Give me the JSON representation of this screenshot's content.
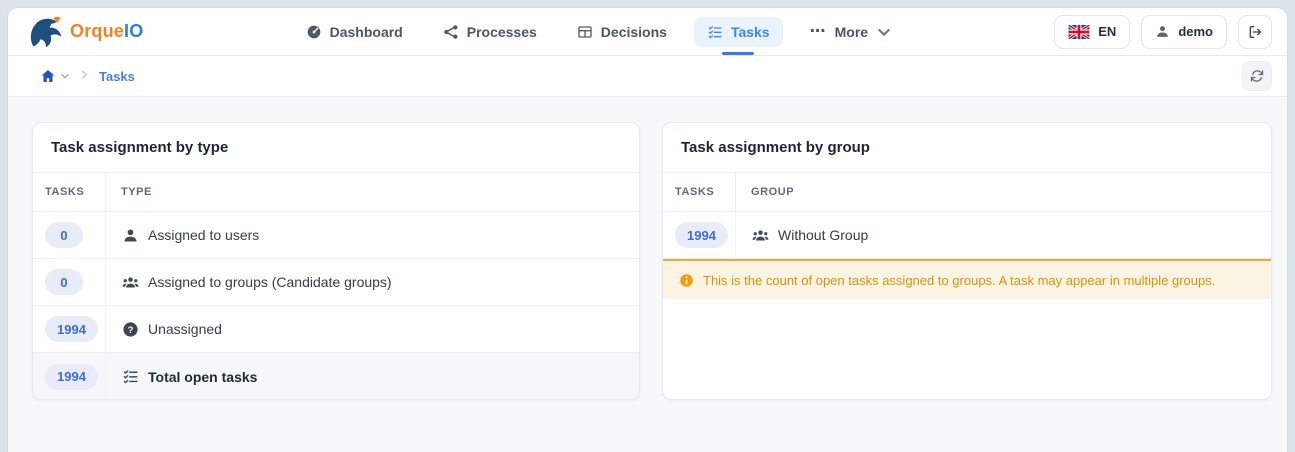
{
  "brand": {
    "name_primary": "Orque",
    "name_secondary": "IO"
  },
  "nav": {
    "items": [
      {
        "label": "Dashboard",
        "icon": "dashboard-gauge-icon",
        "active": false
      },
      {
        "label": "Processes",
        "icon": "processes-nodes-icon",
        "active": false
      },
      {
        "label": "Decisions",
        "icon": "decisions-table-icon",
        "active": false
      },
      {
        "label": "Tasks",
        "icon": "tasks-checklist-icon",
        "active": true
      },
      {
        "label": "More",
        "icon": "more-ellipsis-icon",
        "active": false
      }
    ]
  },
  "topbar_right": {
    "language_label": "EN",
    "language_icon": "uk-flag-icon",
    "username": "demo",
    "user_icon": "person-icon",
    "logout_icon": "sign-out-icon"
  },
  "breadcrumb": {
    "home_icon": "home-icon",
    "current": "Tasks",
    "refresh_icon": "refresh-icon"
  },
  "cards": {
    "by_type": {
      "title": "Task assignment by type",
      "columns": [
        "TASKS",
        "TYPE"
      ],
      "rows": [
        {
          "count": "0",
          "label": "Assigned to users",
          "icon": "user-icon"
        },
        {
          "count": "0",
          "label": "Assigned to groups (Candidate groups)",
          "icon": "users-icon"
        },
        {
          "count": "1994",
          "label": "Unassigned",
          "icon": "question-circle-icon"
        },
        {
          "count": "1994",
          "label": "Total open tasks",
          "icon": "tasks-checklist-icon",
          "total": true
        }
      ]
    },
    "by_group": {
      "title": "Task assignment by group",
      "columns": [
        "TASKS",
        "GROUP"
      ],
      "rows": [
        {
          "count": "1994",
          "label": "Without Group",
          "icon": "users-icon"
        }
      ],
      "notice": "This is the count of open tasks assigned to groups. A task may appear in multiple groups.",
      "notice_icon": "info-circle-icon"
    }
  },
  "colors": {
    "brand_orange": "#f5821f",
    "brand_blue": "#2e7de0",
    "accent_blue": "#3d87f5",
    "active_tab_bg": "#eaf2fe",
    "badge_bg": "#e8ecf9",
    "badge_text": "#3f6be0",
    "notice_bg": "#fcf4e3",
    "notice_text": "#d8920e",
    "notice_border": "#efa83e",
    "page_bg": "#f7f8fa",
    "outer_bg": "#dde3ea"
  }
}
